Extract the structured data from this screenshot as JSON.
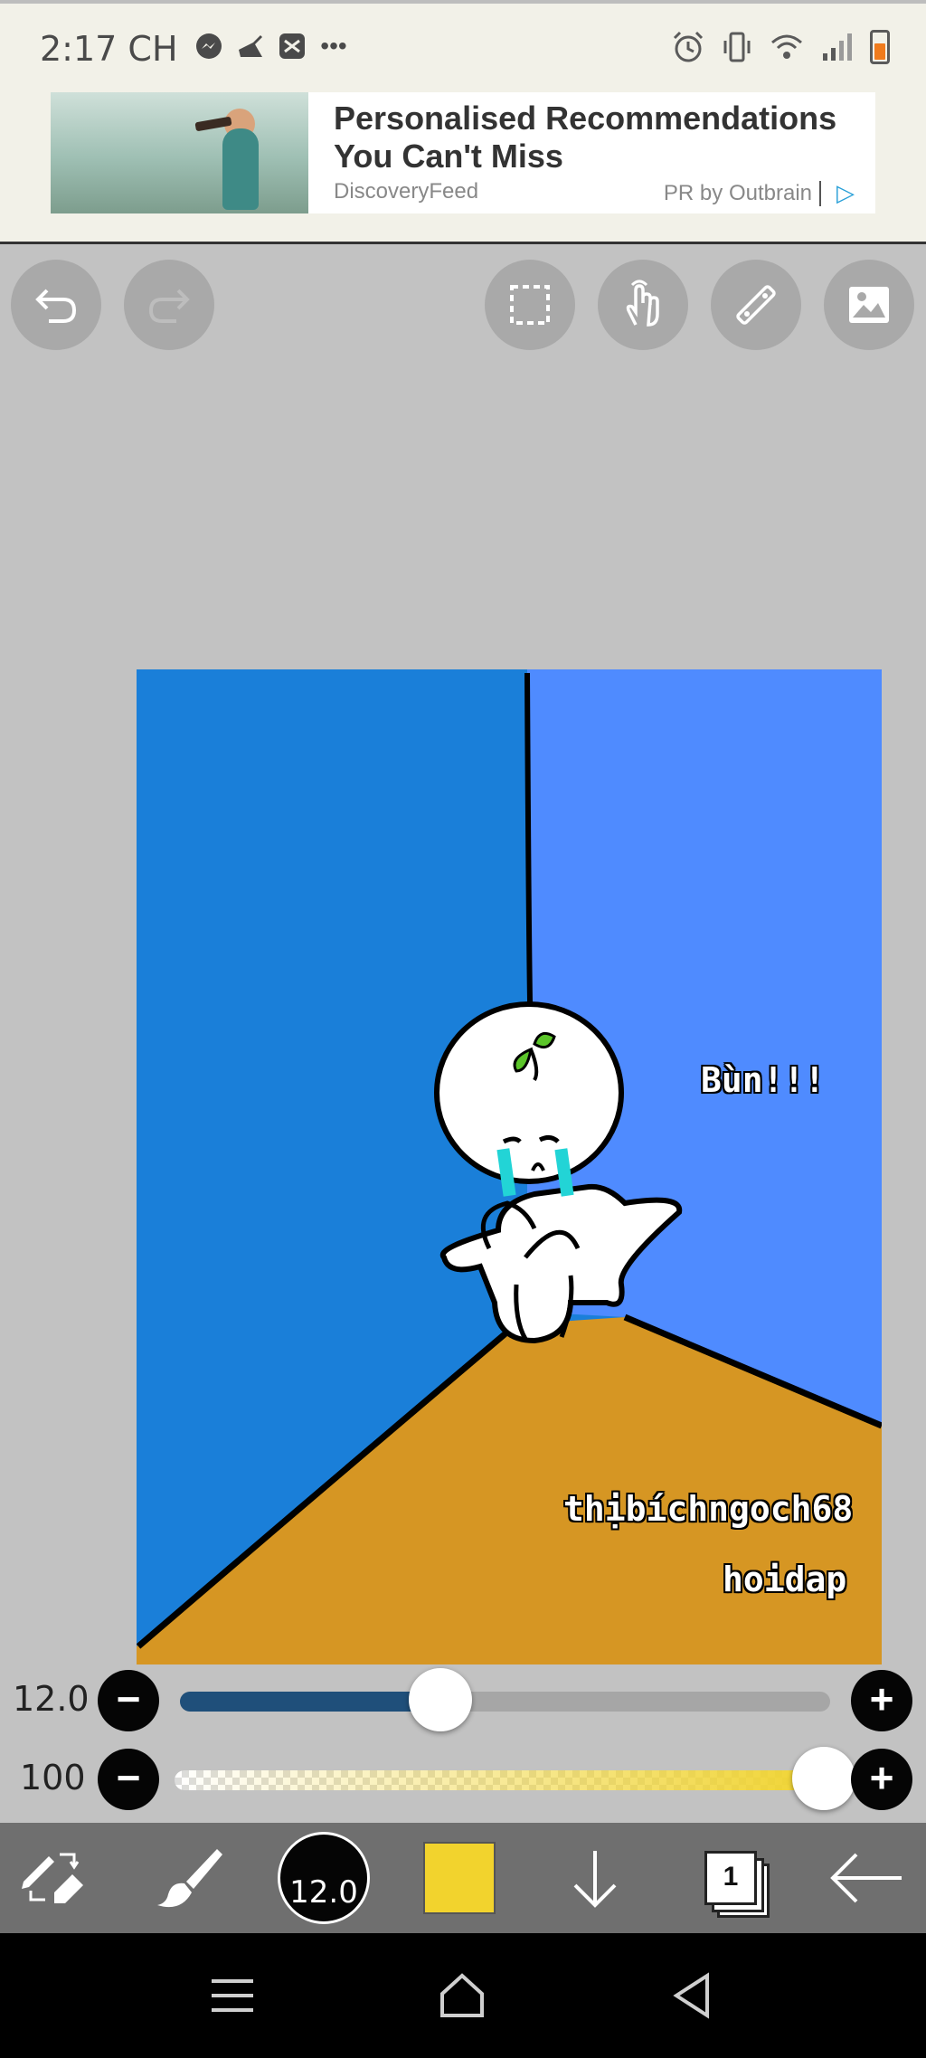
{
  "status_bar": {
    "time": "2:17 CH",
    "more_label": "•••"
  },
  "ad": {
    "title": "Personalised Recommendations You Can't Miss",
    "source": "DiscoveryFeed",
    "by": "PR by Outbrain"
  },
  "toolbar_top": {
    "icons": [
      "undo-icon",
      "redo-icon",
      "selection-icon",
      "hand-icon",
      "ruler-icon",
      "image-icon"
    ]
  },
  "canvas": {
    "text_bun": "Bùn!!!",
    "text_user": "thịbíchngoch68",
    "text_site": "hoidap",
    "colors": {
      "left_wall": "#1a7fd9",
      "right_wall": "#4f8bff",
      "floor": "#d69623"
    }
  },
  "brush_size_slider": {
    "value_label": "12.0",
    "level": 0.4
  },
  "opacity_slider": {
    "value_label": "100",
    "level": 1.0
  },
  "bottom_toolbar": {
    "brush_size_label": "12.0",
    "layer_count": "1",
    "color": "#f2d32d"
  },
  "nav_bar": {
    "icons": [
      "recent-apps-icon",
      "home-icon",
      "back-icon"
    ]
  }
}
